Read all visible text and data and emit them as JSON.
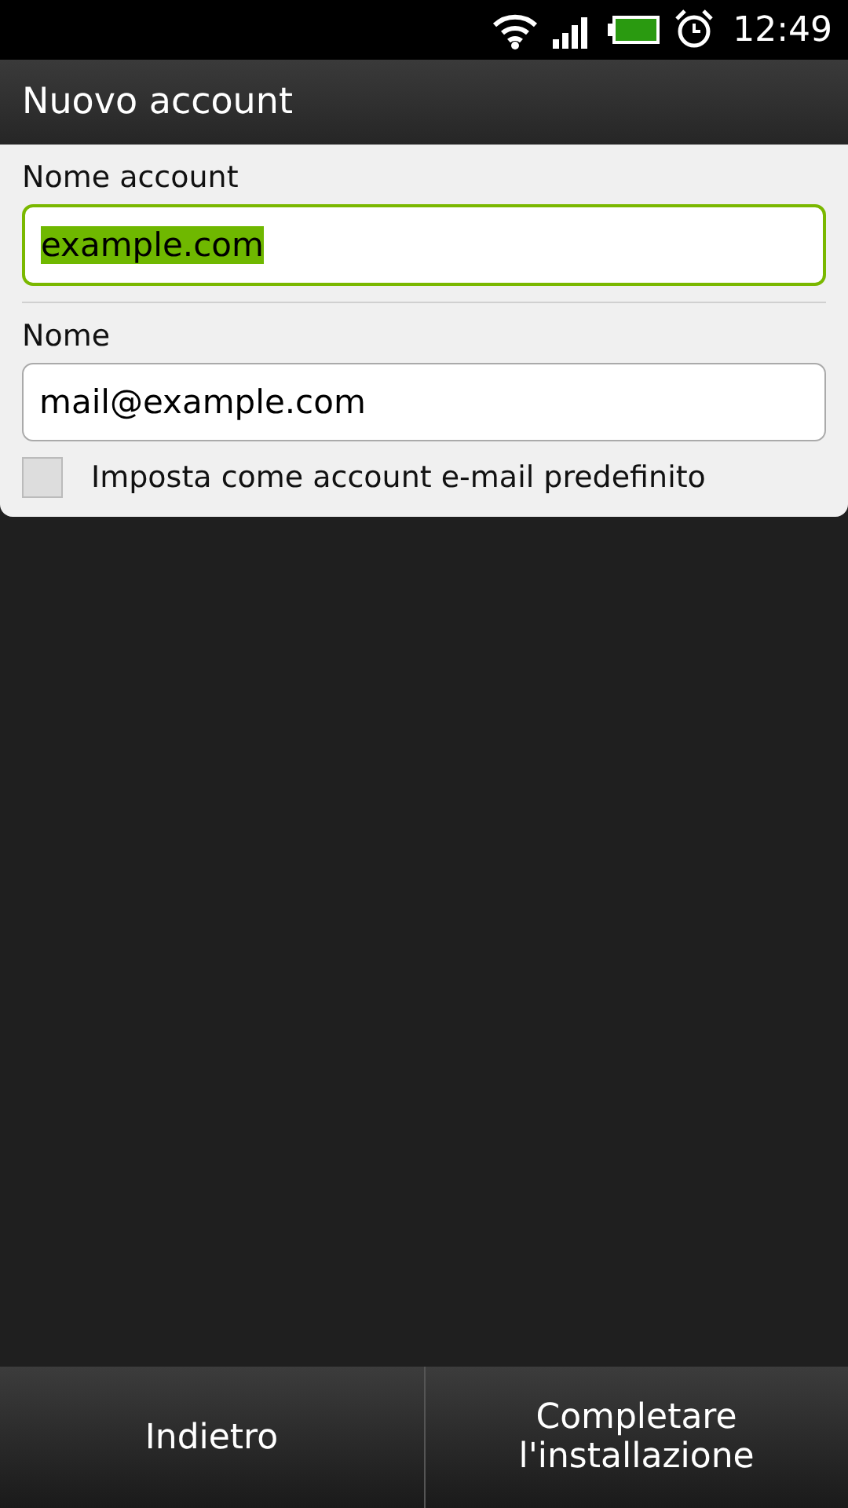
{
  "status_bar": {
    "time": "12:49"
  },
  "window": {
    "title": "Nuovo account"
  },
  "fields": [
    {
      "label": "Nome account",
      "value": "example.com",
      "focused": true,
      "text_selected": true
    },
    {
      "label": "Nome",
      "value": "mail@example.com",
      "focused": false,
      "text_selected": false
    }
  ],
  "checkbox": {
    "label": "Imposta come account e-mail predefinito",
    "checked": false
  },
  "buttons": [
    {
      "label": "Indietro"
    },
    {
      "label": "Completare l'installazione"
    }
  ]
}
